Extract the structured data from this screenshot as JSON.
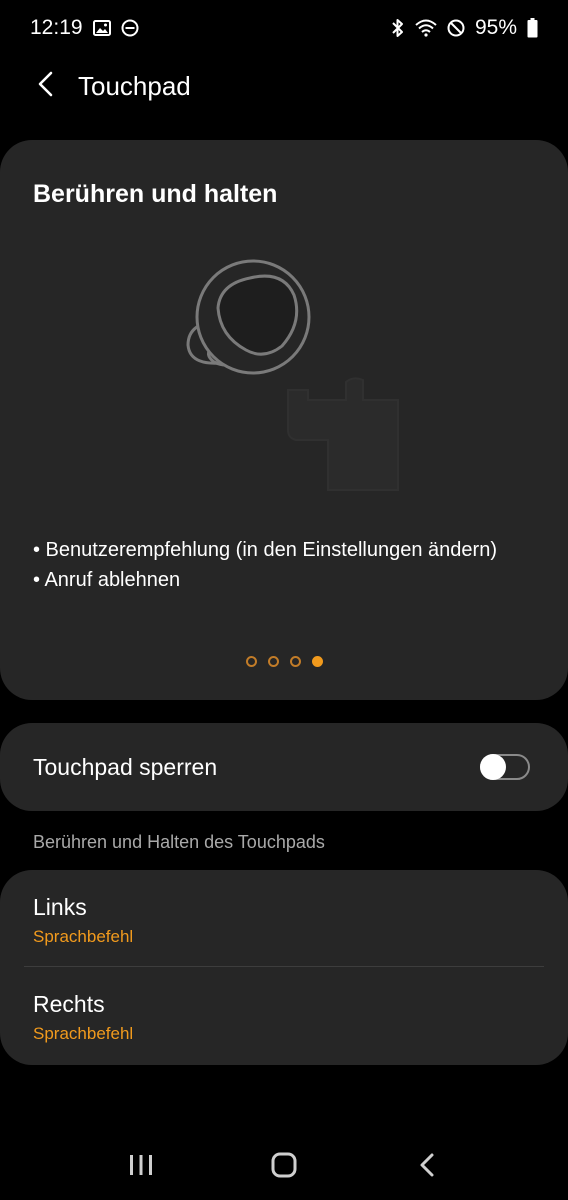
{
  "status_bar": {
    "time": "12:19",
    "battery_percent": "95%",
    "icons_left": [
      "image-icon",
      "do-not-disturb-icon"
    ],
    "icons_right": [
      "bluetooth-icon",
      "wifi-icon",
      "blocked-icon",
      "battery-icon"
    ]
  },
  "header": {
    "title": "Touchpad",
    "back_icon": "chevron-left-icon"
  },
  "hero": {
    "title": "Berühren und halten",
    "illustration": "earbud-touch-icon",
    "lines": [
      "• Benutzerempfehlung (in den Einstellungen ändern)",
      "• Anruf ablehnen"
    ],
    "pages_total": 4,
    "active_page": 4
  },
  "lock": {
    "label": "Touchpad sperren",
    "enabled": false
  },
  "section": {
    "label": "Berühren und Halten des Touchpads"
  },
  "list": [
    {
      "title": "Links",
      "subtitle": "Sprachbefehl"
    },
    {
      "title": "Rechts",
      "subtitle": "Sprachbefehl"
    }
  ],
  "colors": {
    "background": "#000000",
    "card": "#262626",
    "accent": "#f19a1d",
    "secondary_text": "#a9a9a9"
  },
  "nav_bar": {
    "buttons": [
      "recent-apps-icon",
      "home-icon",
      "back-icon"
    ]
  }
}
